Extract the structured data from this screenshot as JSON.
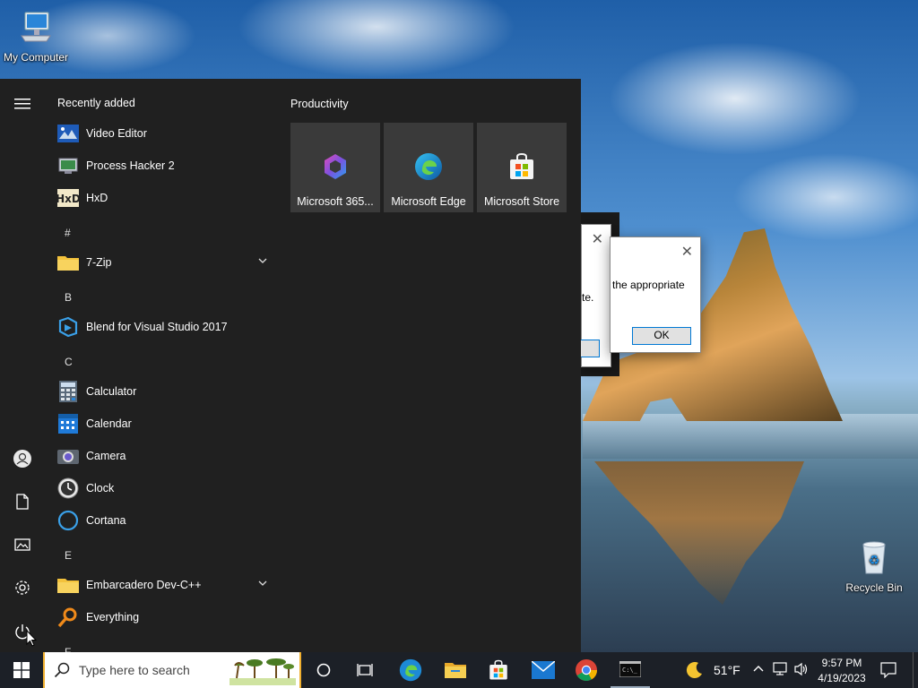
{
  "desktop": {
    "icons": [
      {
        "label": "My Computer",
        "icon": "computer-icon"
      },
      {
        "label": "Recycle Bin",
        "icon": "recycle-bin-icon"
      }
    ]
  },
  "dialogs": [
    {
      "text": "te.",
      "button_label": ""
    },
    {
      "text": "the appropriate",
      "button_label": "OK"
    }
  ],
  "start_menu": {
    "recently_added_title": "Recently added",
    "productivity_title": "Productivity",
    "apps": [
      {
        "label": "Video Editor",
        "icon": "video-editor-icon"
      },
      {
        "label": "Process Hacker 2",
        "icon": "process-hacker-icon"
      },
      {
        "label": "HxD",
        "icon": "hxd-icon"
      },
      {
        "label": "7-Zip",
        "icon": "folder-icon",
        "expandable": true
      },
      {
        "label": "Blend for Visual Studio 2017",
        "icon": "blend-icon"
      },
      {
        "label": "Calculator",
        "icon": "calculator-icon"
      },
      {
        "label": "Calendar",
        "icon": "calendar-icon"
      },
      {
        "label": "Camera",
        "icon": "camera-icon"
      },
      {
        "label": "Clock",
        "icon": "clock-icon"
      },
      {
        "label": "Cortana",
        "icon": "cortana-icon"
      },
      {
        "label": "Embarcadero Dev-C++",
        "icon": "folder-icon",
        "expandable": true
      },
      {
        "label": "Everything",
        "icon": "everything-icon"
      }
    ],
    "letters": [
      "#",
      "B",
      "C",
      "E",
      "F"
    ],
    "tiles": [
      {
        "label": "Microsoft 365...",
        "icon": "microsoft-365-icon"
      },
      {
        "label": "Microsoft Edge",
        "icon": "edge-icon"
      },
      {
        "label": "Microsoft Store",
        "icon": "store-icon"
      }
    ],
    "rail": [
      "hamburger-menu-icon",
      "user-icon",
      "documents-icon",
      "pictures-icon",
      "settings-icon",
      "power-icon"
    ]
  },
  "taskbar": {
    "search_placeholder": "Type here to search",
    "pinned": [
      "cortana-circle-icon",
      "task-view-icon",
      "edge-icon",
      "file-explorer-icon",
      "store-icon",
      "mail-icon",
      "chrome-icon",
      "terminal-icon"
    ],
    "weather_temp": "51°F",
    "time": "9:57 PM",
    "date": "4/19/2023"
  },
  "colors": {
    "start_bg": "#202020",
    "tile_bg": "#3a3a3a",
    "taskbar_bg": "#1c2027",
    "accent": "#0078d4"
  }
}
